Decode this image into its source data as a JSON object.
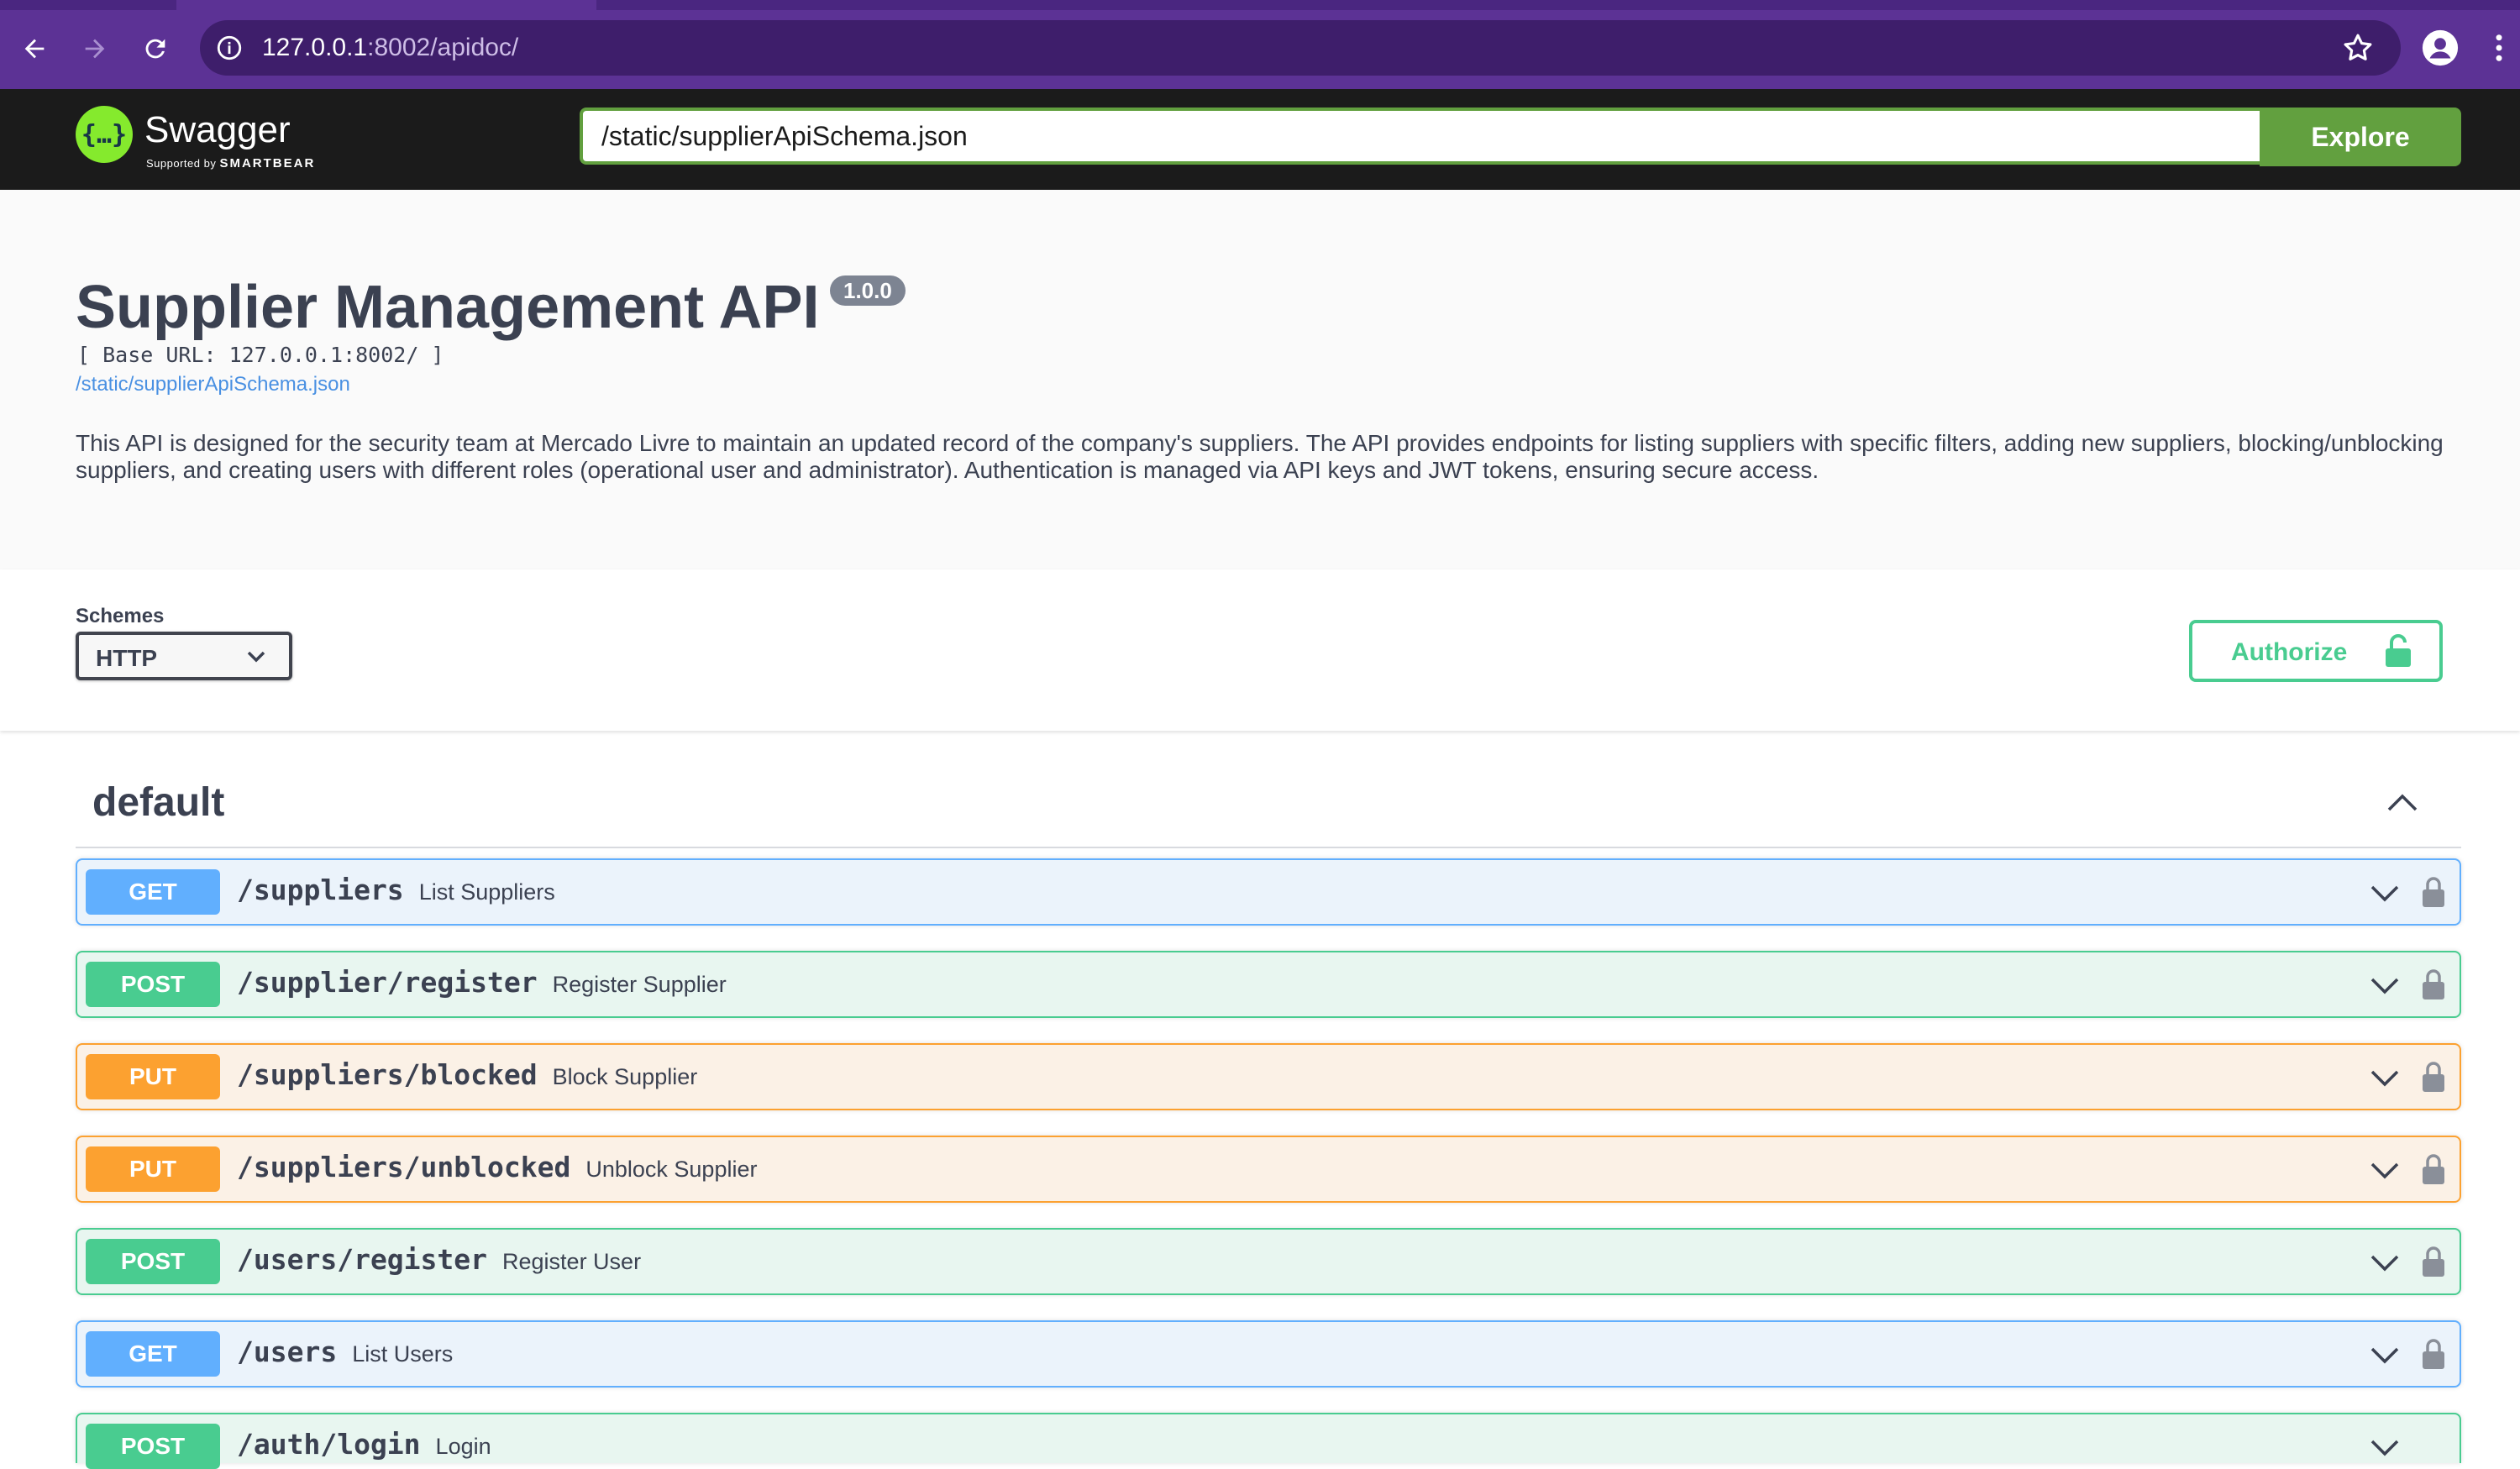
{
  "browser": {
    "url_host": "127.0.0.1",
    "url_rest": ":8002/apidoc/",
    "theme_color": "#5c3295"
  },
  "topbar": {
    "logo_name": "Swagger",
    "logo_sub_prefix": "Supported by ",
    "logo_sub_brand": "SMARTBEAR",
    "spec_url": "/static/supplierApiSchema.json",
    "explore_label": "Explore"
  },
  "info": {
    "title": "Supplier Management API",
    "version": "1.0.0",
    "base_url": "[ Base URL: 127.0.0.1:8002/ ]",
    "spec_link": "/static/supplierApiSchema.json",
    "description": "This API is designed for the security team at Mercado Livre to maintain an updated record of the company's suppliers. The API provides endpoints for listing suppliers with specific filters, adding new suppliers, blocking/unblocking suppliers, and creating users with different roles (operational user and administrator). Authentication is managed via API keys and JWT tokens, ensuring secure access."
  },
  "schemes": {
    "title": "Schemes",
    "selected": "HTTP",
    "authorize_label": "Authorize"
  },
  "tag": {
    "name": "default"
  },
  "colors": {
    "get": "#61affe",
    "post": "#49cc90",
    "put": "#fca130",
    "explore": "#62a03f"
  },
  "operations": [
    {
      "method": "GET",
      "path": "/suppliers",
      "summary": "List Suppliers"
    },
    {
      "method": "POST",
      "path": "/supplier/register",
      "summary": "Register Supplier"
    },
    {
      "method": "PUT",
      "path": "/suppliers/blocked",
      "summary": "Block Supplier"
    },
    {
      "method": "PUT",
      "path": "/suppliers/unblocked",
      "summary": "Unblock Supplier"
    },
    {
      "method": "POST",
      "path": "/users/register",
      "summary": "Register User"
    },
    {
      "method": "GET",
      "path": "/users",
      "summary": "List Users"
    },
    {
      "method": "POST",
      "path": "/auth/login",
      "summary": "Login"
    }
  ]
}
